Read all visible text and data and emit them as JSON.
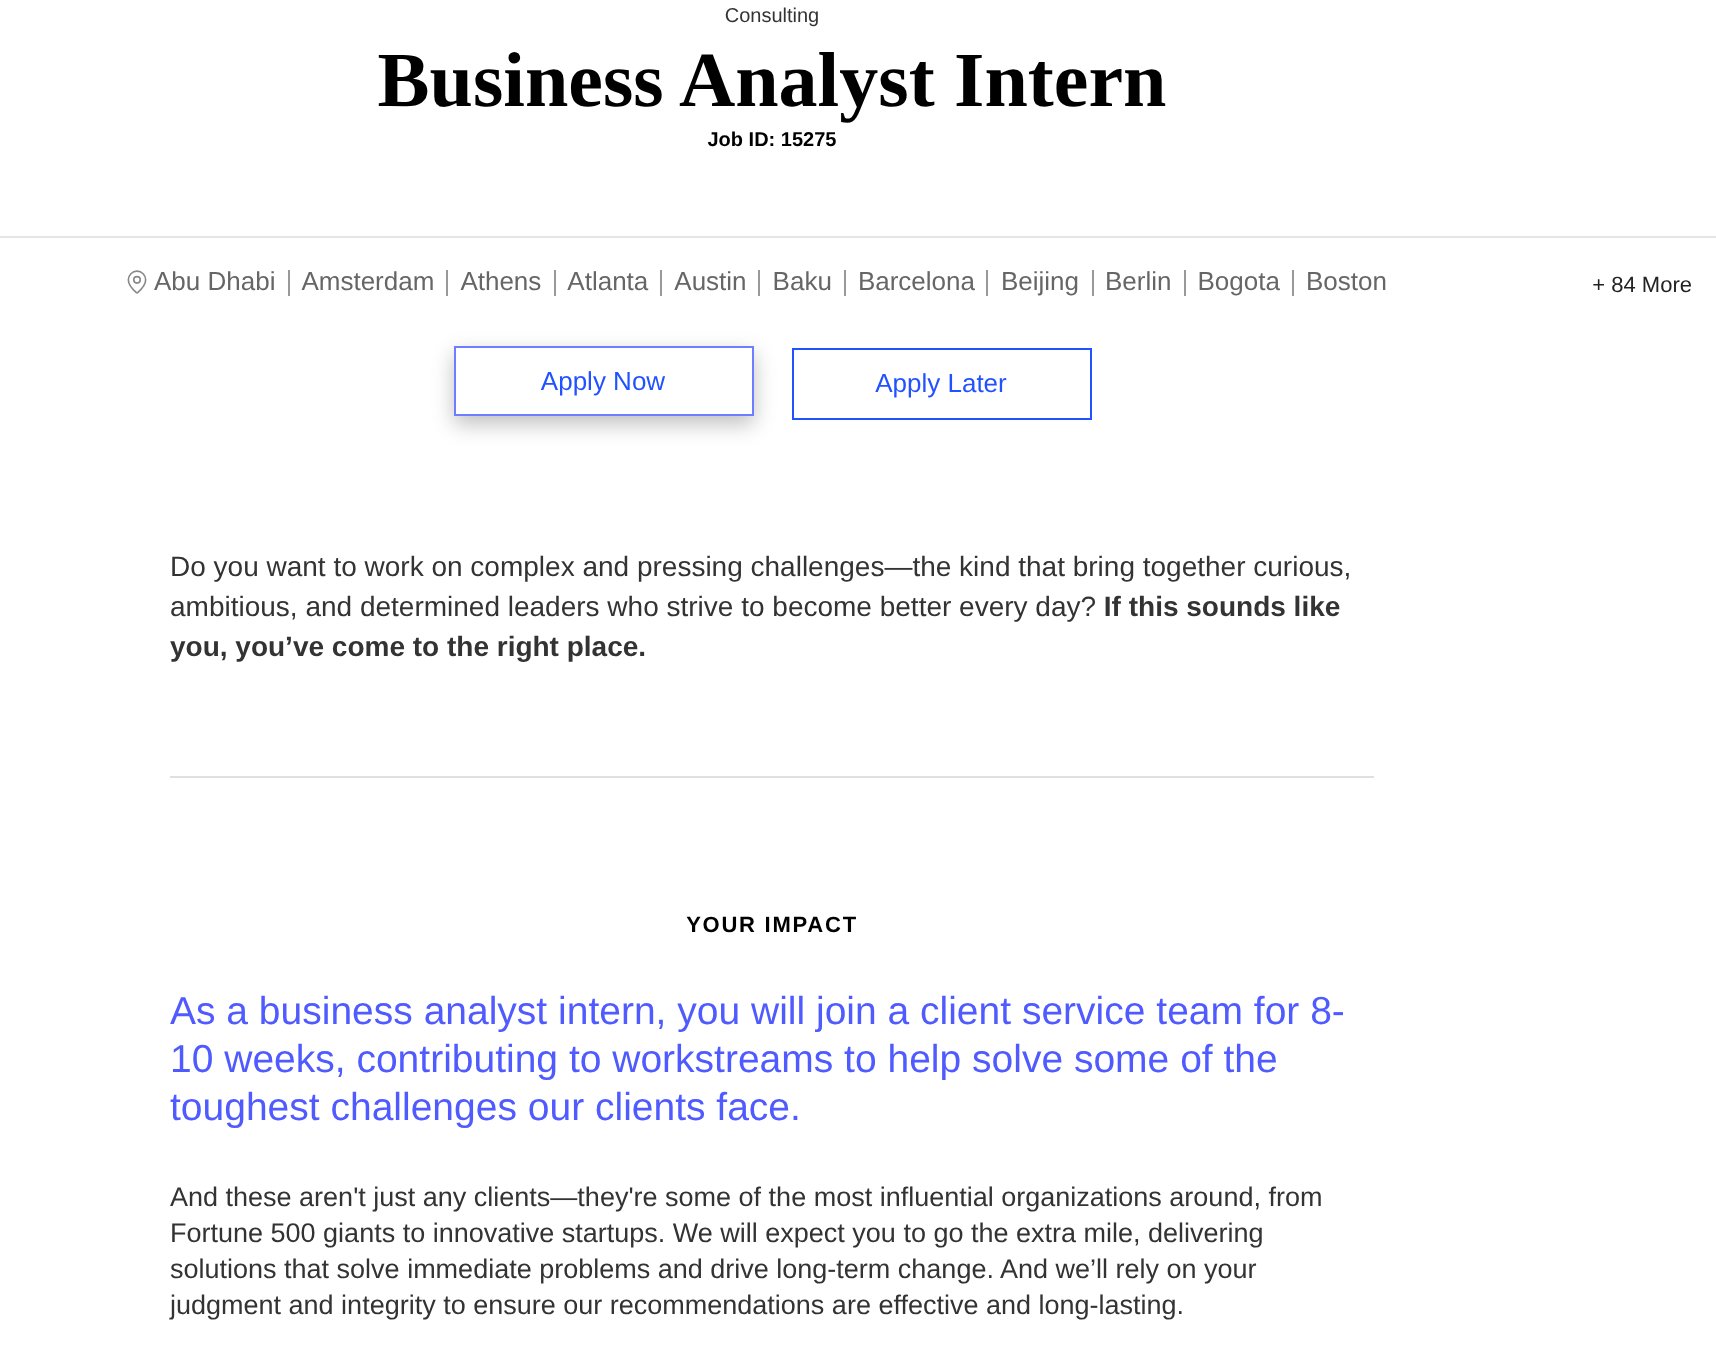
{
  "header": {
    "category": "Consulting",
    "title": "Business Analyst Intern",
    "job_id": "Job ID: 15275"
  },
  "locations": {
    "items": [
      "Abu Dhabi",
      "Amsterdam",
      "Athens",
      "Atlanta",
      "Austin",
      "Baku",
      "Barcelona",
      "Beijing",
      "Berlin",
      "Bogota",
      "Boston"
    ],
    "more": "+ 84 More"
  },
  "actions": [
    {
      "label": "Apply Now",
      "highlighted": true
    },
    {
      "label": "Apply Later",
      "highlighted": false
    }
  ],
  "intro": "Do you want to work on complex and pressing challenges—the kind that bring together curious, ambitious, and determined leaders who strive to become better every day? **If this sounds like you, you’ve come to the right place.**",
  "impact": {
    "heading": "YOUR IMPACT",
    "lead": "As a business analyst intern, you will join a client service team for 8-10 weeks, contributing to workstreams to help solve some of the toughest challenges our clients face.",
    "body": "And these aren't just any clients—they're some of the most influential organizations around, from Fortune 500 giants to innovative startups. We will expect you to go the extra mile, delivering solutions that solve immediate problems and drive long-term change. And we’ll rely on your judgment and integrity to ensure our recommendations are effective and long-lasting."
  }
}
